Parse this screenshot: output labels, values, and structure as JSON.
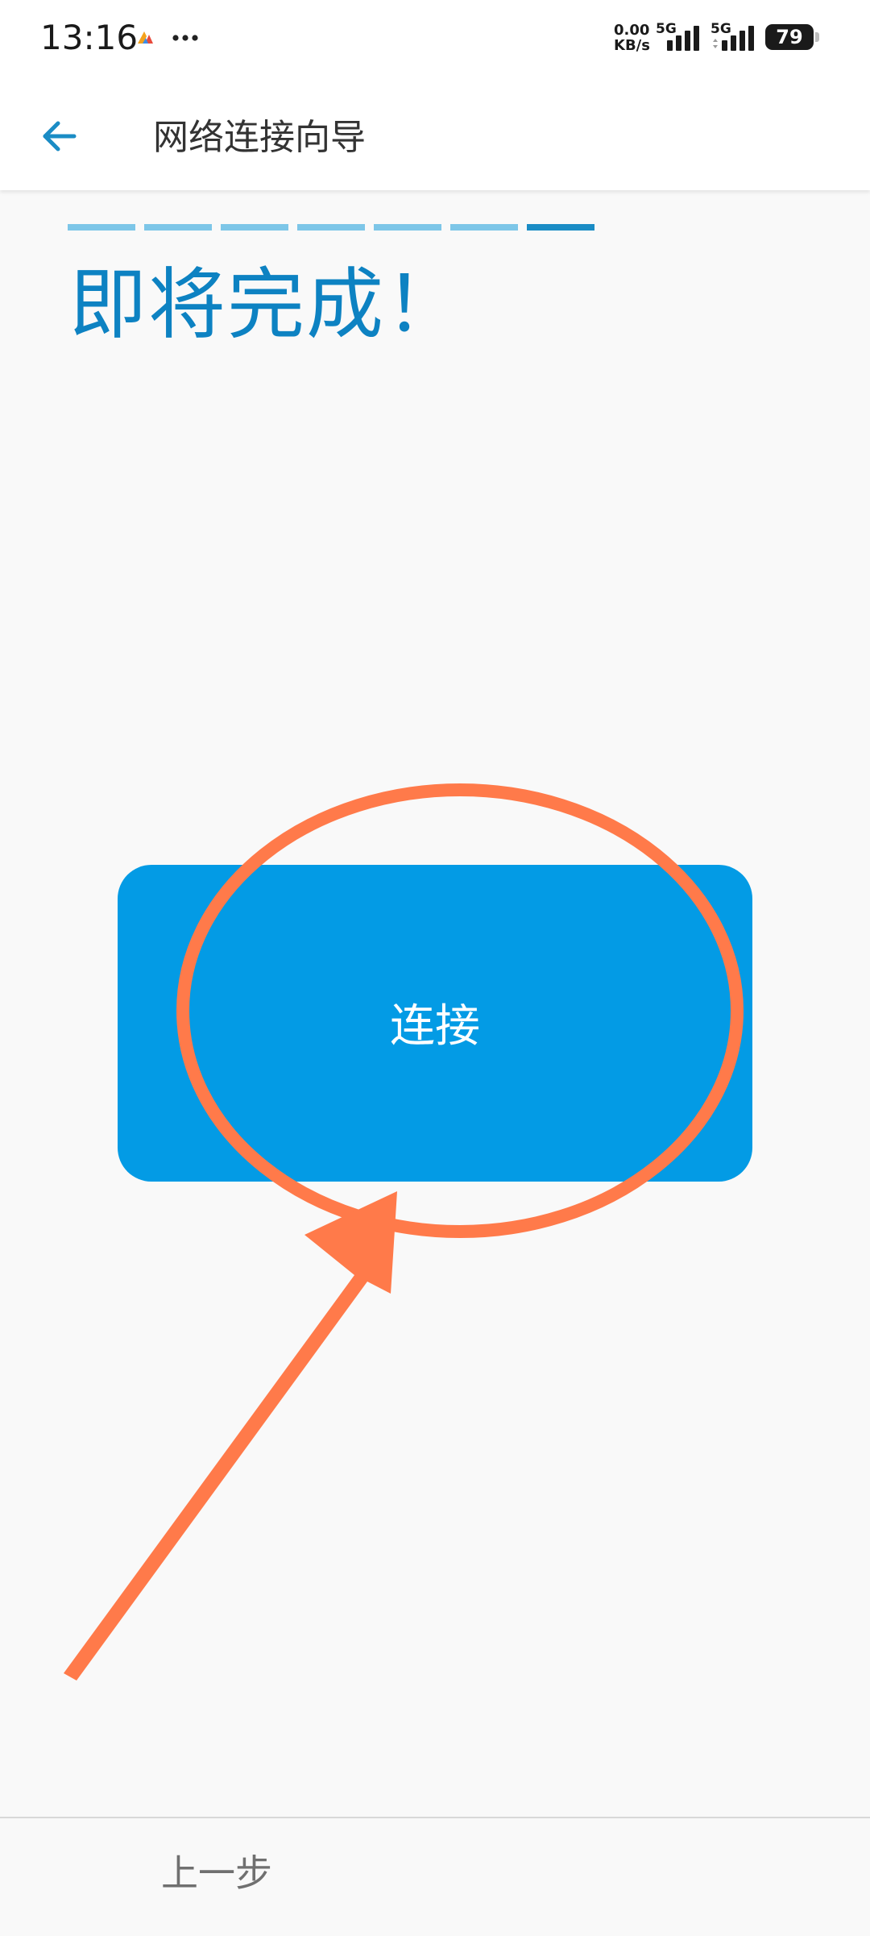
{
  "status_bar": {
    "time": "13:16",
    "more_glyph": "•••",
    "net_speed_value": "0.00",
    "net_speed_unit": "KB/s",
    "signal_1_label": "5G",
    "signal_2_label": "5G",
    "battery_level": "79",
    "icons": [
      "app-notification-icon",
      "more-icon",
      "signal-icon",
      "battery-icon"
    ]
  },
  "appbar": {
    "back_icon": "arrow-left-icon",
    "title": "网络连接向导"
  },
  "wizard": {
    "steps_total": 7,
    "current_step": 7,
    "headline": "即将完成！"
  },
  "main": {
    "connect_label": "连接"
  },
  "footer": {
    "prev_label": "上一步"
  },
  "colors": {
    "accent": "#039be5",
    "headline": "#0d82c2",
    "progress_done": "#7dc6e8",
    "progress_current": "#1a8cc5",
    "annotation": "#ff7a4a"
  }
}
